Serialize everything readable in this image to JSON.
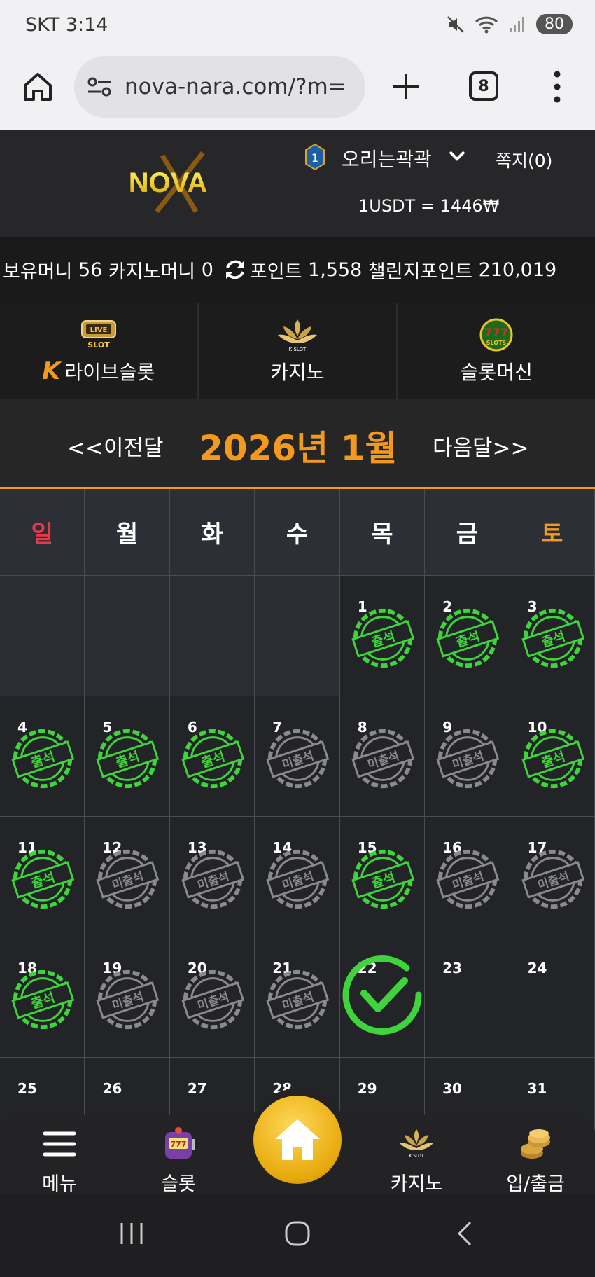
{
  "status_bar": {
    "carrier_time": "SKT 3:14",
    "battery": "80"
  },
  "browser": {
    "url": "nova-nara.com/?m=",
    "tab_count": "8"
  },
  "header": {
    "logo_text": "NOVA",
    "level": "1",
    "username": "오리는곽곽",
    "messages": "쪽지(0)",
    "exchange_rate": "1USDT = 1446₩"
  },
  "balance": {
    "holding_label": "보유머니",
    "holding_value": "56",
    "casino_label": "카지노머니",
    "casino_value": "0",
    "point_label": "포인트",
    "point_value": "1,558",
    "challenge_label": "챌린지포인트",
    "challenge_value": "210,019"
  },
  "game_tabs": [
    {
      "label": "라이브슬롯",
      "icon": "live-slot-icon",
      "prefix": "K"
    },
    {
      "label": "카지노",
      "icon": "k-slot-icon"
    },
    {
      "label": "슬롯머신",
      "icon": "777-slots-icon"
    }
  ],
  "calendar": {
    "prev_label": "<<이전달",
    "title": "2026년 1월",
    "next_label": "다음달>>",
    "weekdays": [
      "일",
      "월",
      "화",
      "수",
      "목",
      "금",
      "토"
    ],
    "leading_empty": 4,
    "stamp_attended": "출석",
    "stamp_missed": "미출석",
    "days": [
      {
        "n": "1",
        "s": "attended"
      },
      {
        "n": "2",
        "s": "attended"
      },
      {
        "n": "3",
        "s": "attended"
      },
      {
        "n": "4",
        "s": "attended"
      },
      {
        "n": "5",
        "s": "attended"
      },
      {
        "n": "6",
        "s": "attended"
      },
      {
        "n": "7",
        "s": "missed"
      },
      {
        "n": "8",
        "s": "missed"
      },
      {
        "n": "9",
        "s": "missed"
      },
      {
        "n": "10",
        "s": "attended"
      },
      {
        "n": "11",
        "s": "attended"
      },
      {
        "n": "12",
        "s": "missed"
      },
      {
        "n": "13",
        "s": "missed"
      },
      {
        "n": "14",
        "s": "missed"
      },
      {
        "n": "15",
        "s": "attended"
      },
      {
        "n": "16",
        "s": "missed"
      },
      {
        "n": "17",
        "s": "missed"
      },
      {
        "n": "18",
        "s": "attended"
      },
      {
        "n": "19",
        "s": "missed"
      },
      {
        "n": "20",
        "s": "missed"
      },
      {
        "n": "21",
        "s": "missed"
      },
      {
        "n": "22",
        "s": "today"
      },
      {
        "n": "23",
        "s": ""
      },
      {
        "n": "24",
        "s": ""
      },
      {
        "n": "25",
        "s": ""
      },
      {
        "n": "26",
        "s": ""
      },
      {
        "n": "27",
        "s": ""
      },
      {
        "n": "28",
        "s": ""
      },
      {
        "n": "29",
        "s": ""
      },
      {
        "n": "30",
        "s": ""
      },
      {
        "n": "31",
        "s": ""
      }
    ]
  },
  "bottom_nav": {
    "menu": "메뉴",
    "slot": "슬롯",
    "casino": "카지노",
    "deposit": "입/출금"
  },
  "colors": {
    "accent": "#f39a1e",
    "attended": "#3fd43b",
    "missed": "#8a8a8a",
    "sunday": "#e83a4c"
  }
}
